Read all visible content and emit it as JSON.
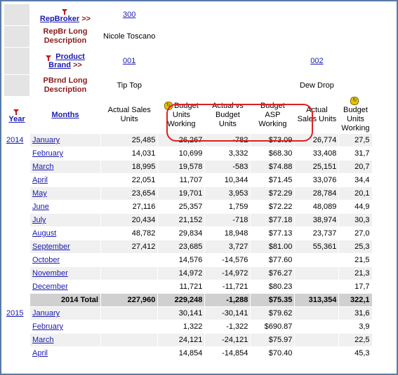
{
  "filters": {
    "repbroker_label": "RepBroker",
    "repbroker_arrows": ">>",
    "repbroker_value": "300",
    "repbr_long_label": "RepBr Long Description",
    "repbr_long_value": "Nicole Toscano",
    "product_brand_label_line1": "Product",
    "product_brand_label_line2": "Brand",
    "product_brand_arrows": ">>",
    "brand_1": "001",
    "brand_2": "002",
    "pbrnd_long_label": "PBrnd Long Description",
    "brand_1_desc": "Tip Top",
    "brand_2_desc": "Dew Drop"
  },
  "columns": {
    "year": "Year",
    "months": "Months",
    "actual_sales_units": "Actual Sales Units",
    "budget_units_working": "Budget Units Working",
    "actual_vs_budget_units": "Actual vs Budget Units",
    "budget_asp_working": "Budget ASP Working",
    "actual_sales_units_2": "Actual Sales Units",
    "budget_units_working_2": "Budget Units Working"
  },
  "rows": [
    {
      "year": "2014",
      "month": "January",
      "actual": "25,485",
      "budget": "26,267",
      "diff": "-782",
      "asp": "$73.09",
      "actual2": "26,774",
      "budget2": "27,5"
    },
    {
      "year": "",
      "month": "February",
      "actual": "14,031",
      "budget": "10,699",
      "diff": "3,332",
      "asp": "$68.30",
      "actual2": "33,408",
      "budget2": "31,7"
    },
    {
      "year": "",
      "month": "March",
      "actual": "18,995",
      "budget": "19,578",
      "diff": "-583",
      "asp": "$74.88",
      "actual2": "25,151",
      "budget2": "20,7"
    },
    {
      "year": "",
      "month": "April",
      "actual": "22,051",
      "budget": "11,707",
      "diff": "10,344",
      "asp": "$71.45",
      "actual2": "33,076",
      "budget2": "34,4"
    },
    {
      "year": "",
      "month": "May",
      "actual": "23,654",
      "budget": "19,701",
      "diff": "3,953",
      "asp": "$72.29",
      "actual2": "28,784",
      "budget2": "20,1"
    },
    {
      "year": "",
      "month": "June",
      "actual": "27,116",
      "budget": "25,357",
      "diff": "1,759",
      "asp": "$72.22",
      "actual2": "48,089",
      "budget2": "44,9"
    },
    {
      "year": "",
      "month": "July",
      "actual": "20,434",
      "budget": "21,152",
      "diff": "-718",
      "asp": "$77.18",
      "actual2": "38,974",
      "budget2": "30,3"
    },
    {
      "year": "",
      "month": "August",
      "actual": "48,782",
      "budget": "29,834",
      "diff": "18,948",
      "asp": "$77.13",
      "actual2": "23,737",
      "budget2": "27,0"
    },
    {
      "year": "",
      "month": "September",
      "actual": "27,412",
      "budget": "23,685",
      "diff": "3,727",
      "asp": "$81.00",
      "actual2": "55,361",
      "budget2": "25,3"
    },
    {
      "year": "",
      "month": "October",
      "actual": "",
      "budget": "14,576",
      "diff": "-14,576",
      "asp": "$77.60",
      "actual2": "",
      "budget2": "21,5"
    },
    {
      "year": "",
      "month": "November",
      "actual": "",
      "budget": "14,972",
      "diff": "-14,972",
      "asp": "$76.27",
      "actual2": "",
      "budget2": "21,3"
    },
    {
      "year": "",
      "month": "December",
      "actual": "",
      "budget": "11,721",
      "diff": "-11,721",
      "asp": "$80.23",
      "actual2": "",
      "budget2": "17,7"
    }
  ],
  "total_2014": {
    "label": "2014 Total",
    "actual": "227,960",
    "budget": "229,248",
    "diff": "-1,288",
    "asp": "$75.35",
    "actual2": "313,354",
    "budget2": "322,1"
  },
  "rows_2015": [
    {
      "year": "2015",
      "month": "January",
      "actual": "",
      "budget": "30,141",
      "diff": "-30,141",
      "asp": "$79.62",
      "actual2": "",
      "budget2": "31,6"
    },
    {
      "year": "",
      "month": "February",
      "actual": "",
      "budget": "1,322",
      "diff": "-1,322",
      "asp": "$690.87",
      "actual2": "",
      "budget2": "3,9"
    },
    {
      "year": "",
      "month": "March",
      "actual": "",
      "budget": "24,121",
      "diff": "-24,121",
      "asp": "$75.97",
      "actual2": "",
      "budget2": "22,5"
    },
    {
      "year": "",
      "month": "April",
      "actual": "",
      "budget": "14,854",
      "diff": "-14,854",
      "asp": "$70.40",
      "actual2": "",
      "budget2": "45,3"
    }
  ]
}
